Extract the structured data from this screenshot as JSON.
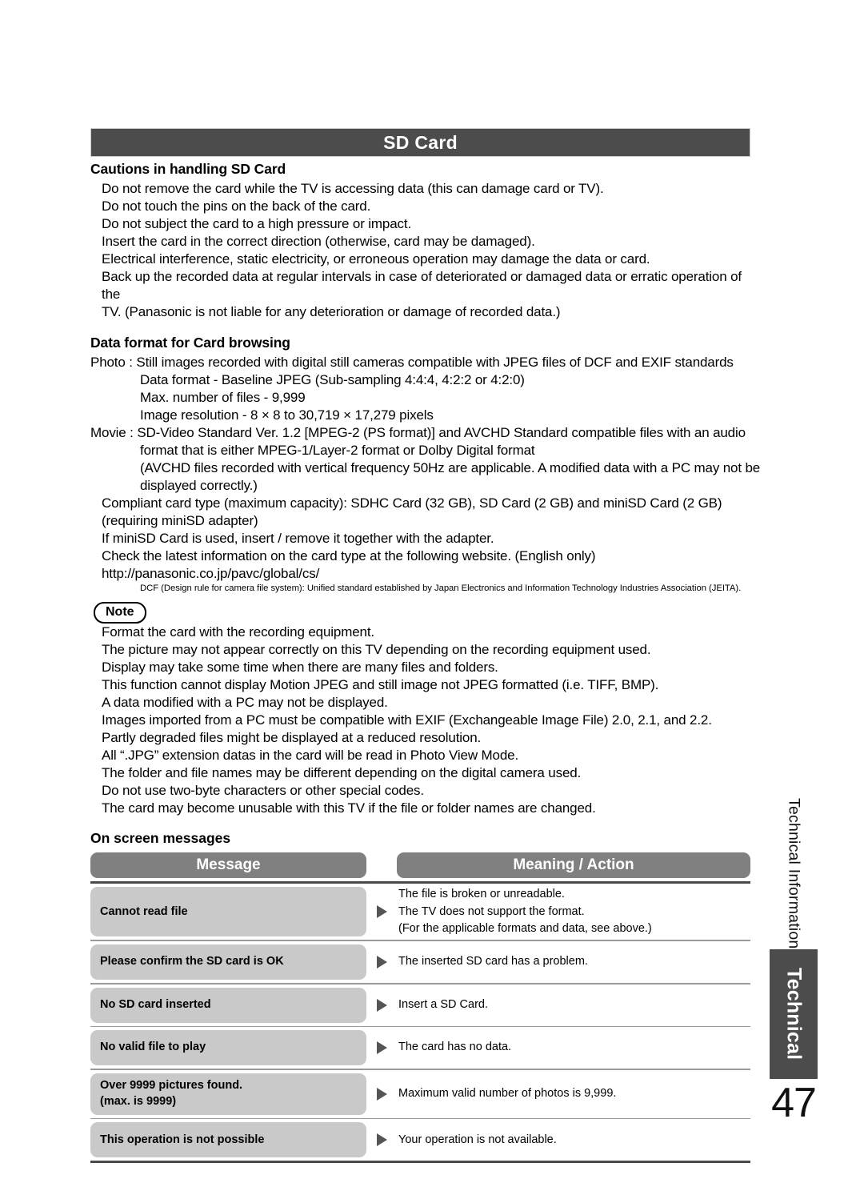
{
  "section": {
    "title": "SD Card"
  },
  "cautions": {
    "heading": "Cautions in handling SD Card",
    "items": [
      "Do not remove the card while the TV is accessing data (this can damage card or TV).",
      "Do not touch the pins on the back of the card.",
      "Do not subject the card to a high pressure or impact.",
      "Insert the card in the correct direction (otherwise, card may be damaged).",
      "Electrical interference, static electricity, or erroneous operation may damage the data or card.",
      "Back up the recorded data at regular intervals in case of deteriorated or damaged data or erratic operation of the",
      "TV. (Panasonic is not liable for any deterioration or damage of recorded data.)"
    ]
  },
  "data_format": {
    "heading": "Data format for Card browsing",
    "photo_line": "Photo : Still images recorded with digital still cameras compatible with JPEG files of DCF   and EXIF standards",
    "photo_details": [
      "Data format - Baseline JPEG (Sub-sampling 4:4:4, 4:2:2 or 4:2:0)",
      "Max. number of files - 9,999",
      "Image resolution - 8 × 8 to 30,719 × 17,279 pixels"
    ],
    "movie_line": "Movie : SD-Video Standard Ver. 1.2 [MPEG-2 (PS format)] and AVCHD Standard compatible files with an audio",
    "movie_details": [
      "format that is either MPEG-1/Layer-2 format or Dolby Digital format",
      "(AVCHD files recorded with vertical frequency 50Hz are applicable. A modified data with a PC may not be",
      "displayed correctly.)"
    ],
    "card_notes": [
      "Compliant card type (maximum capacity): SDHC Card (32 GB), SD Card (2 GB) and miniSD Card (2 GB)",
      "(requiring miniSD adapter)",
      "If miniSD Card is used, insert / remove it together with the adapter.",
      "Check the latest information on the card type at the following website. (English only)",
      "http://panasonic.co.jp/pavc/global/cs/"
    ],
    "footnote": "DCF (Design rule for camera file system): Unified standard established by Japan Electronics and Information Technology Industries Association (JEITA)."
  },
  "note": {
    "badge": "Note",
    "items": [
      "Format the card with the recording equipment.",
      "The picture may not appear correctly on this TV depending on the recording equipment used.",
      "Display may take some time when there are many files and folders.",
      "This function cannot display Motion JPEG and still image not JPEG formatted (i.e. TIFF, BMP).",
      "A data modified with a PC may not be displayed.",
      "Images imported from a PC must be compatible with EXIF (Exchangeable Image File) 2.0, 2.1, and 2.2.",
      "Partly degraded files might be displayed at a reduced resolution.",
      "All “.JPG” extension datas in the card will be read in Photo View Mode.",
      "The folder and file names may be different depending on the digital camera used.",
      "Do not use two-byte characters or other special codes.",
      "The card may become unusable with this TV if the file or folder names are changed."
    ]
  },
  "on_screen_messages": {
    "heading": "On screen messages",
    "columns": {
      "message": "Message",
      "meaning": "Meaning / Action"
    },
    "rows": [
      {
        "message": "Cannot read file",
        "meaning": [
          "The file is broken or unreadable.",
          "The TV does not support the format.",
          "(For the applicable formats and data, see above.)"
        ]
      },
      {
        "message": "Please confirm the SD card is OK",
        "meaning": [
          "The inserted SD card has a problem."
        ]
      },
      {
        "message": "No SD card inserted",
        "meaning": [
          "Insert a SD Card."
        ]
      },
      {
        "message": "No valid file to play",
        "meaning": [
          "The card has no data."
        ]
      },
      {
        "message": "Over 9999 pictures found.\n(max. is 9999)",
        "meaning": [
          "Maximum valid number of photos is 9,999."
        ]
      },
      {
        "message": "This operation is not possible",
        "meaning": [
          "Your operation is not available."
        ]
      }
    ]
  },
  "sidebar": {
    "chapter_label": "Technical Information",
    "tab_label": "Technical"
  },
  "footer": {
    "page_number": "47"
  },
  "colors": {
    "bar_dark": "#4c4c4c",
    "header_cell": "#808080",
    "msg_cell": "#c9c9c9",
    "rule": "#4a4a4a"
  }
}
